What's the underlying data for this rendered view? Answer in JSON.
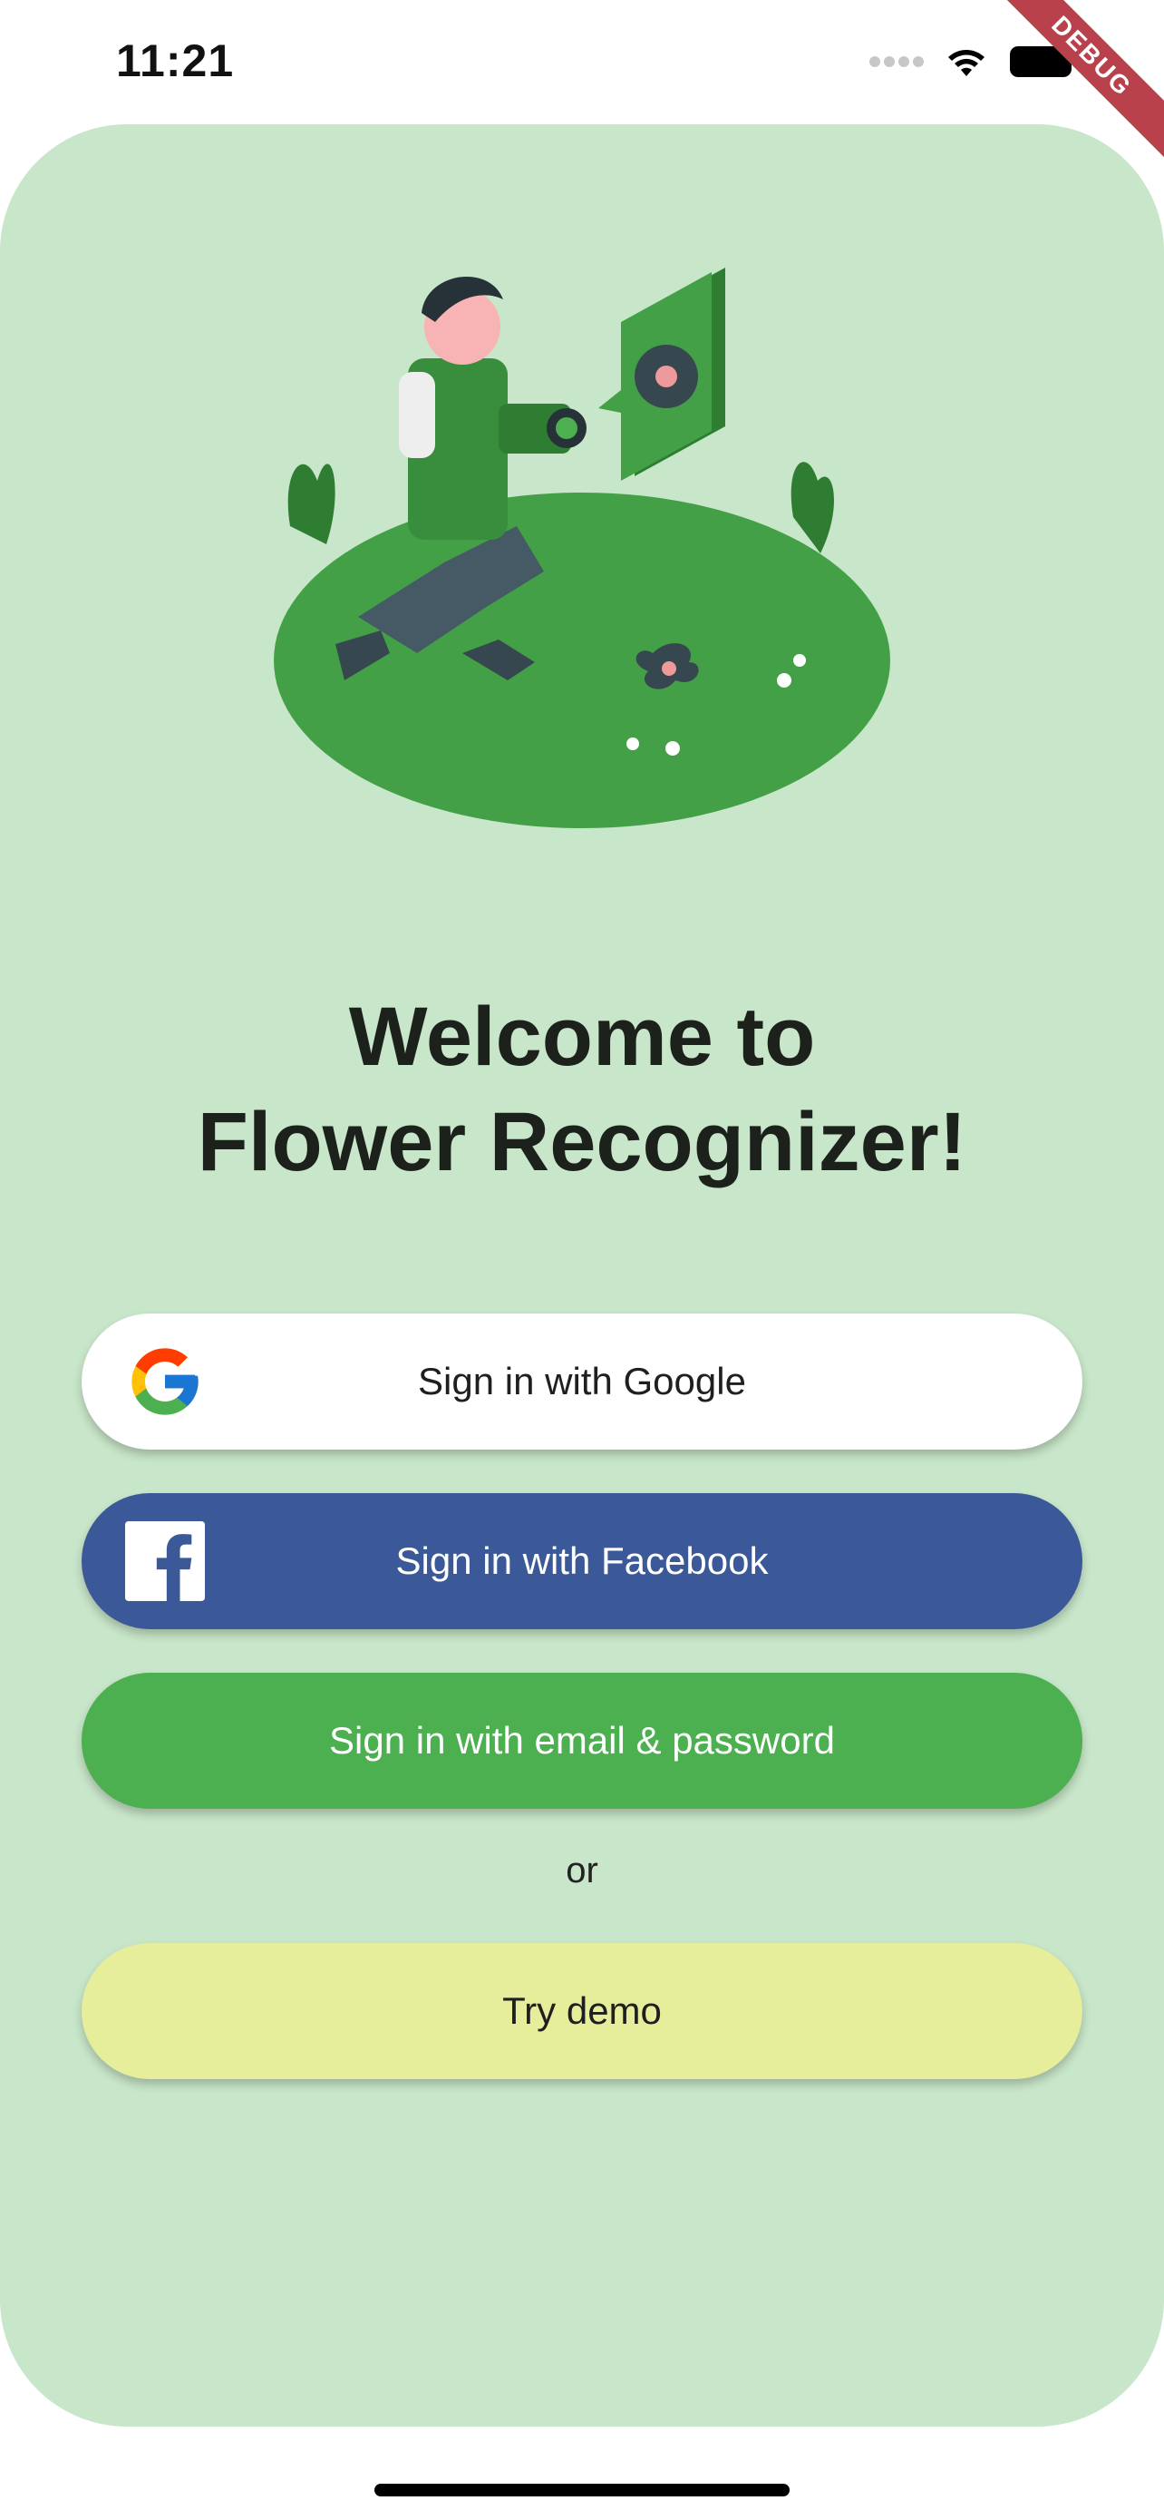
{
  "status_bar": {
    "time": "11:21",
    "icons": [
      "signal-dots-icon",
      "wifi-icon",
      "battery-icon"
    ],
    "debug_label": "DEBUG"
  },
  "welcome": {
    "line1": "Welcome to",
    "line2": "Flower Recognizer!"
  },
  "buttons": {
    "google": {
      "label": "Sign in with Google",
      "icon": "google-logo-icon"
    },
    "facebook": {
      "label": "Sign in with Facebook",
      "icon": "facebook-logo-icon"
    },
    "email": {
      "label": "Sign in with email & password"
    },
    "demo": {
      "label": "Try demo"
    }
  },
  "or_text": "or",
  "colors": {
    "background_card": "#c8e6c9",
    "facebook_blue": "#3b5998",
    "email_green": "#4caf50",
    "demo_yellow": "#e6ee9c",
    "debug_red": "#b9414b"
  }
}
